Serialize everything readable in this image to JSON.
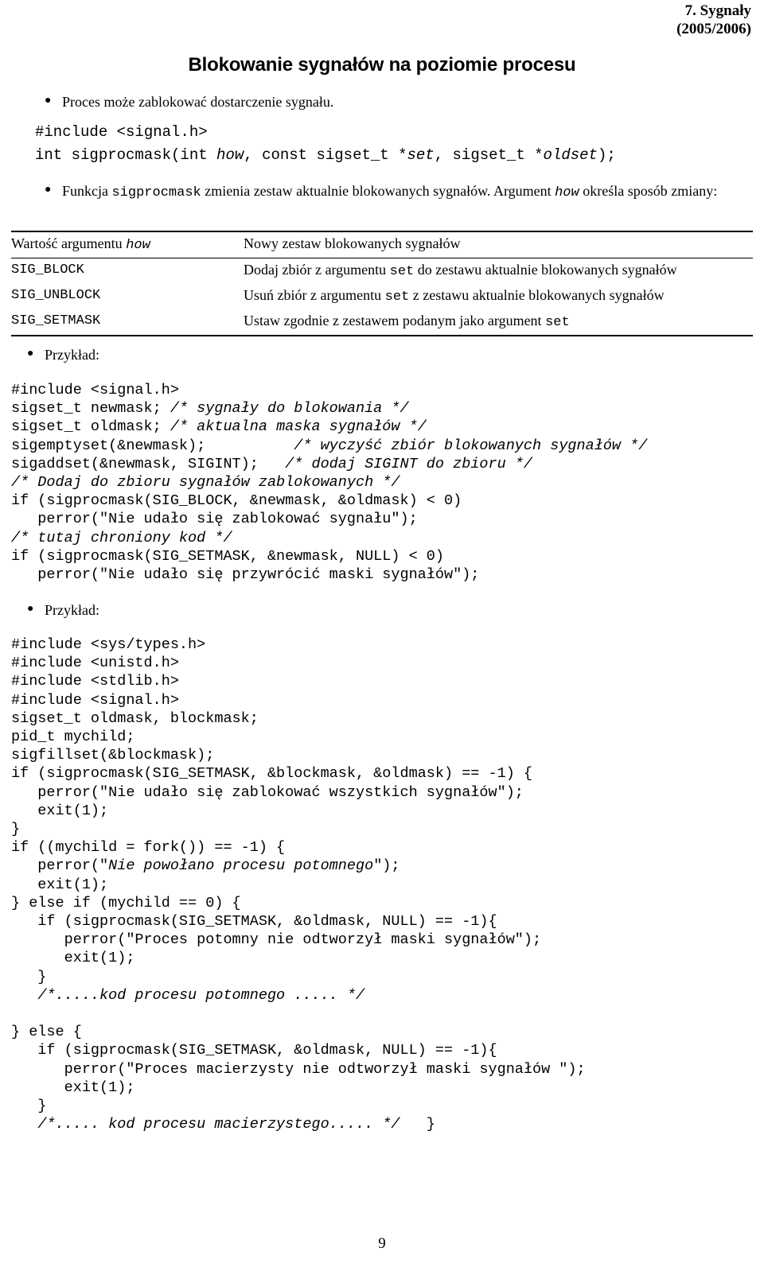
{
  "header": {
    "line1": "7. Sygnały",
    "line2": "(2005/2006)"
  },
  "title": "Blokowanie sygnałów na poziomie procesu",
  "bullets": {
    "intro": "Proces może zablokować dostarczenie sygnału.",
    "example_label_1": "Przykład:",
    "example_label_2": "Przykład:"
  },
  "signature": {
    "include": "#include <signal.h>",
    "prototype_pre": "int sigprocmask(int ",
    "prototype_arg1": "how",
    "prototype_mid1": ", const sigset_t *",
    "prototype_arg2": "set",
    "prototype_mid2": ", sigset_t *",
    "prototype_arg3": "oldset",
    "prototype_end": ");"
  },
  "description": {
    "part1": "Funkcja ",
    "func": "sigprocmask",
    "part2": " zmienia zestaw aktualnie blokowanych sygnałów. Argument ",
    "arg": "how",
    "part3": " określa sposób zmiany:"
  },
  "table": {
    "headers": {
      "col_a_pre": "Wartość argumentu ",
      "col_a_arg": "how",
      "col_b": "Nowy zestaw blokowanych sygnałów"
    },
    "rows": [
      {
        "value": "SIG_BLOCK",
        "desc_pre": "Dodaj zbiór z argumentu ",
        "desc_arg": "set",
        "desc_post": " do zestawu aktualnie blokowanych sygnałów"
      },
      {
        "value": "SIG_UNBLOCK",
        "desc_pre": "Usuń zbiór z argumentu ",
        "desc_arg": "set",
        "desc_post": " z zestawu aktualnie blokowanych sygnałów"
      },
      {
        "value": "SIG_SETMASK",
        "desc_pre": "Ustaw zgodnie z zestawem podanym jako argument ",
        "desc_arg": "set",
        "desc_post": ""
      }
    ]
  },
  "code_block_1": {
    "lines": [
      "#include <signal.h>",
      "sigset_t newmask; /* sygnały do blokowania */",
      "sigset_t oldmask; /* aktualna maska sygnałów */",
      "sigemptyset(&newmask);          /* wyczyść zbiór blokowanych sygnałów */",
      "sigaddset(&newmask, SIGINT);   /* dodaj SIGINT do zbioru */",
      "/* Dodaj do zbioru sygnałów zablokowanych */",
      "if (sigprocmask(SIG_BLOCK, &newmask, &oldmask) < 0)",
      "   perror(\"Nie udało się zablokować sygnału\");",
      "/* tutaj chroniony kod */",
      "if (sigprocmask(SIG_SETMASK, &newmask, NULL) < 0)",
      "   perror(\"Nie udało się przywrócić maski sygnałów\");"
    ]
  },
  "code_block_2": {
    "lines": [
      "#include <sys/types.h>",
      "#include <unistd.h>",
      "#include <stdlib.h>",
      "#include <signal.h>",
      "sigset_t oldmask, blockmask;",
      "pid_t mychild;",
      "sigfillset(&blockmask);",
      "if (sigprocmask(SIG_SETMASK, &blockmask, &oldmask) == -1) {",
      "   perror(\"Nie udało się zablokować wszystkich sygnałów\");",
      "   exit(1);",
      "}",
      "if ((mychild = fork()) == -1) {",
      "   perror(\"Nie powołano procesu potomnego\");",
      "   exit(1);",
      "} else if (mychild == 0) {",
      "   if (sigprocmask(SIG_SETMASK, &oldmask, NULL) == -1){",
      "      perror(\"Proces potomny nie odtworzył maski sygnałów\");",
      "      exit(1);",
      "   }",
      "   /*.....kod procesu potomnego ..... */",
      "",
      "} else {",
      "   if (sigprocmask(SIG_SETMASK, &oldmask, NULL) == -1){",
      "      perror(\"Proces macierzysty nie odtworzył maski sygnałów \");",
      "      exit(1);",
      "   }",
      "   /*..... kod procesu macierzystego..... */   }"
    ]
  },
  "page_number": "9"
}
